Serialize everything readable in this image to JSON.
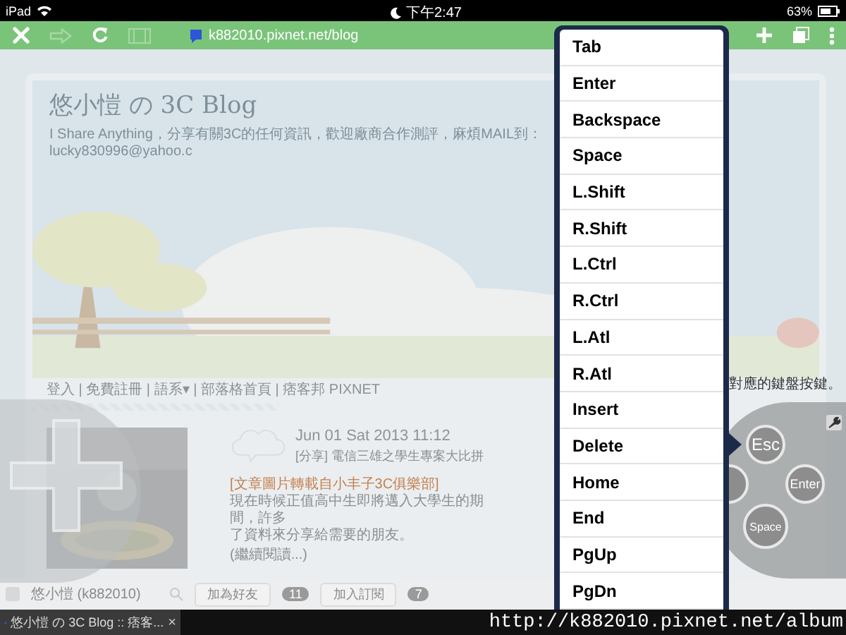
{
  "status_bar": {
    "device": "iPad",
    "time": "下午2:47",
    "battery": "63%"
  },
  "toolbar": {
    "url": "k882010.pixnet.net/blog"
  },
  "blog": {
    "title": "悠小愷 の 3C Blog",
    "subtitle": "I Share Anything，分享有關3C的任何資訊，歡迎廠商合作測評，麻煩MAIL到：lucky830996@yahoo.c",
    "nav": "登入 | 免費註冊 | 語系▾ | 部落格首頁 | 痞客邦 PIXNET",
    "post": {
      "date": "Jun 01 Sat 2013 11:12",
      "title": "[分享] 電信三雄之學生專案大比拼",
      "source": "[文章圖片轉載自小丰子3C俱樂部]",
      "body": [
        "現在時候正值高中生即將邁入大學生的期間，許多",
        "了資料來分享給需要的朋友。"
      ],
      "more": "(繼續閱讀...)"
    },
    "side_text": "對應的鍵盤按鍵。"
  },
  "user_bar": {
    "name": "悠小愷 (k882010)",
    "friend_button": "加為好友",
    "friends": "11",
    "subscribe_button": "加入訂閱",
    "subscribers": "7"
  },
  "controller": {
    "buttons": [
      {
        "label": "Esc",
        "kind": "top"
      },
      {
        "label": "Enter",
        "kind": "right"
      },
      {
        "label": "Space",
        "kind": "bottom"
      }
    ]
  },
  "key_menu": {
    "items": [
      "Tab",
      "Enter",
      "Backspace",
      "Space",
      "L.Shift",
      "R.Shift",
      "L.Ctrl",
      "R.Ctrl",
      "L.Atl",
      "R.Atl",
      "Insert",
      "Delete",
      "Home",
      "End",
      "PgUp",
      "PgDn"
    ]
  },
  "tab_bar": {
    "tab": "悠小愷 の 3C Blog :: 痞客...",
    "close": "×",
    "url": "http://k882010.pixnet.net/album"
  }
}
